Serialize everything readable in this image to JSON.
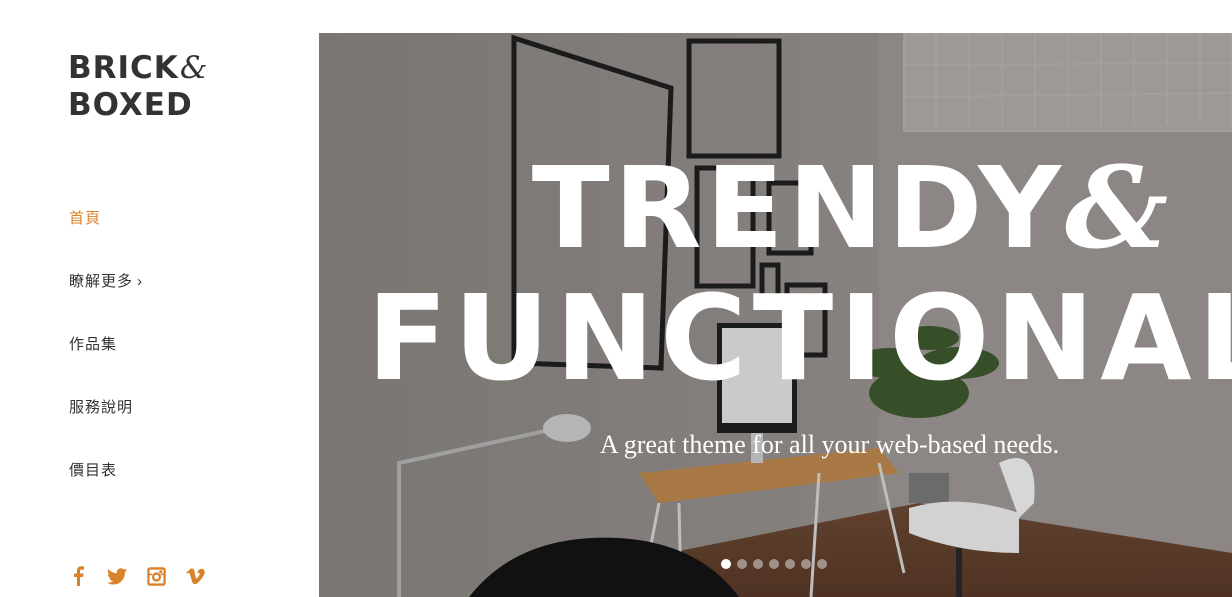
{
  "brand": {
    "line1": "BRICK",
    "amp": "&",
    "line2": "BOXED"
  },
  "nav": {
    "items": [
      {
        "label": "首頁",
        "active": true
      },
      {
        "label": "瞭解更多",
        "has_submenu": true,
        "chevron": "›"
      },
      {
        "label": "作品集"
      },
      {
        "label": "服務說明"
      },
      {
        "label": "價目表"
      }
    ]
  },
  "social": [
    "facebook-icon",
    "twitter-icon",
    "instagram-icon",
    "vimeo-icon"
  ],
  "hero": {
    "title_line1": "TRENDY",
    "title_amp": "&",
    "title_line2": "FUNCTIONAL",
    "subtitle": "A great theme for all your web-based needs.",
    "slides_count": 7,
    "active_slide": 1
  },
  "colors": {
    "accent": "#d9822b",
    "text": "#333333",
    "background": "#ffffff"
  }
}
